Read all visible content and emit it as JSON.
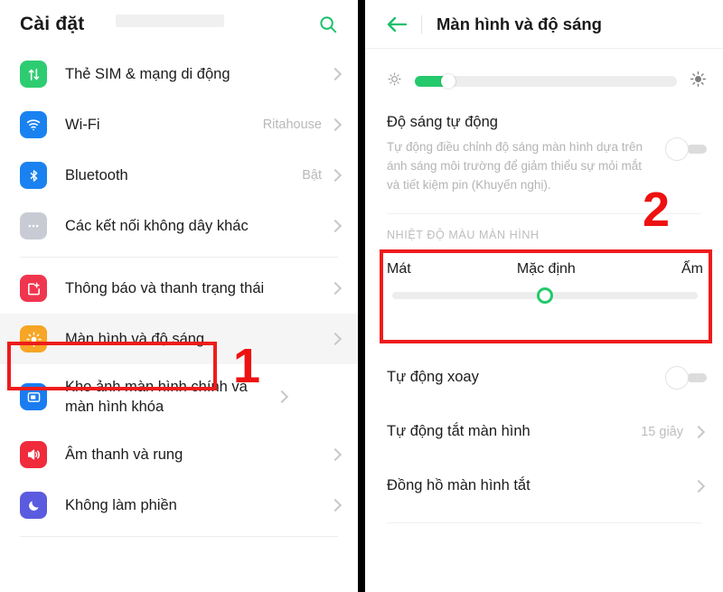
{
  "colors": {
    "accent_green": "#23c96a",
    "annotation_red": "#ee1c1c",
    "sim_icon": "#2ecc71",
    "wifi_icon": "#1a82f0",
    "bluetooth_icon": "#1a82f0",
    "other_conn_icon": "#c9cbd4",
    "notification_icon": "#f0364f",
    "display_icon": "#f7a525",
    "wallpaper_icon": "#1a7cf0",
    "sound_icon": "#ef2b3c",
    "dnd_icon": "#5b5be0"
  },
  "left_panel": {
    "header": {
      "title": "Cài đặt",
      "search_icon": "search-icon"
    },
    "items": [
      {
        "icon": "sim-card-icon",
        "label": "Thẻ SIM & mạng di động",
        "value": "",
        "selected": false,
        "tall": false
      },
      {
        "icon": "wifi-icon",
        "label": "Wi-Fi",
        "value": "Ritahouse",
        "selected": false,
        "tall": false
      },
      {
        "icon": "bluetooth-icon",
        "label": "Bluetooth",
        "value": "Bật",
        "selected": false,
        "tall": false
      },
      {
        "icon": "more-connections-icon",
        "label": "Các kết nối không dây khác",
        "value": "",
        "selected": false,
        "tall": false
      },
      {
        "icon": "notification-icon",
        "label": "Thông báo và thanh trạng thái",
        "value": "",
        "selected": false,
        "tall": false
      },
      {
        "icon": "display-brightness-icon",
        "label": "Màn hình và độ sáng",
        "value": "",
        "selected": true,
        "tall": false
      },
      {
        "icon": "wallpaper-icon",
        "label": "Kho ảnh màn hình chính và màn hình khóa",
        "value": "",
        "selected": false,
        "tall": true
      },
      {
        "icon": "sound-icon",
        "label": "Âm thanh và rung",
        "value": "",
        "selected": false,
        "tall": false
      },
      {
        "icon": "do-not-disturb-icon",
        "label": "Không làm phiền",
        "value": "",
        "selected": false,
        "tall": false
      }
    ]
  },
  "right_panel": {
    "header": {
      "back_icon": "back-arrow-icon",
      "title": "Màn hình và độ sáng"
    },
    "brightness": {
      "low_icon": "brightness-low-icon",
      "high_icon": "brightness-high-icon",
      "value_percent": 13
    },
    "auto_brightness": {
      "title": "Độ sáng tự động",
      "description": "Tự động điều chỉnh độ sáng màn hình dựa trên ánh sáng môi trường để giảm thiểu sự mỏi mắt và tiết kiệm pin (Khuyến nghị).",
      "toggle_state": "off"
    },
    "color_temperature": {
      "section_header": "NHIỆT ĐỘ MÀU MÀN HÌNH",
      "label_left": "Mát",
      "label_center": "Mặc định",
      "label_right": "Ấm",
      "value_percent": 50
    },
    "rows": [
      {
        "label": "Tự động xoay",
        "value": "",
        "control": "toggle-off"
      },
      {
        "label": "Tự động tắt màn hình",
        "value": "15 giây",
        "control": "chevron"
      },
      {
        "label": "Đồng hồ màn hình tắt",
        "value": "",
        "control": "chevron"
      }
    ]
  },
  "annotations": [
    {
      "number": "1",
      "target": "display-brightness-row"
    },
    {
      "number": "2",
      "target": "color-temperature-section"
    }
  ]
}
